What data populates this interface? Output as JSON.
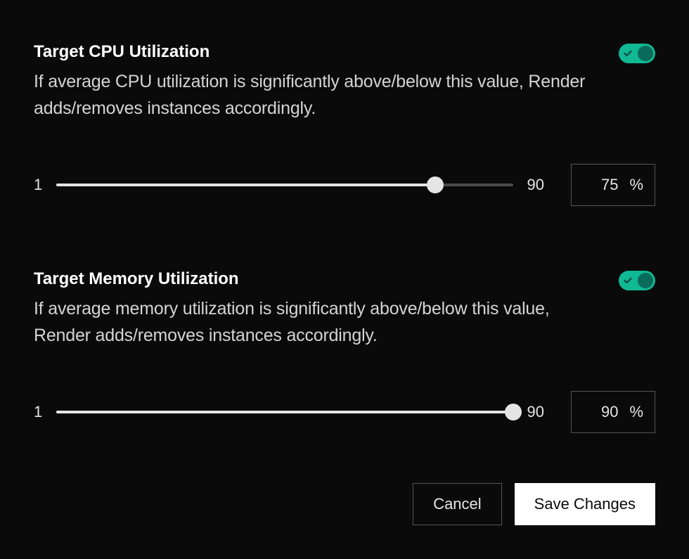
{
  "cpu": {
    "title": "Target CPU Utilization",
    "description": "If average CPU utilization is significantly above/below this value, Render adds/removes instances accordingly.",
    "enabled": true,
    "min": "1",
    "max": "90",
    "value": "75",
    "unit": "%",
    "slider_percent": 83
  },
  "memory": {
    "title": "Target Memory Utilization",
    "description": "If average memory utilization is significantly above/below this value, Render adds/removes instances accordingly.",
    "enabled": true,
    "min": "1",
    "max": "90",
    "value": "90",
    "unit": "%",
    "slider_percent": 100
  },
  "buttons": {
    "cancel": "Cancel",
    "save": "Save Changes"
  },
  "colors": {
    "accent": "#10b893",
    "background": "#0a0a0a"
  }
}
